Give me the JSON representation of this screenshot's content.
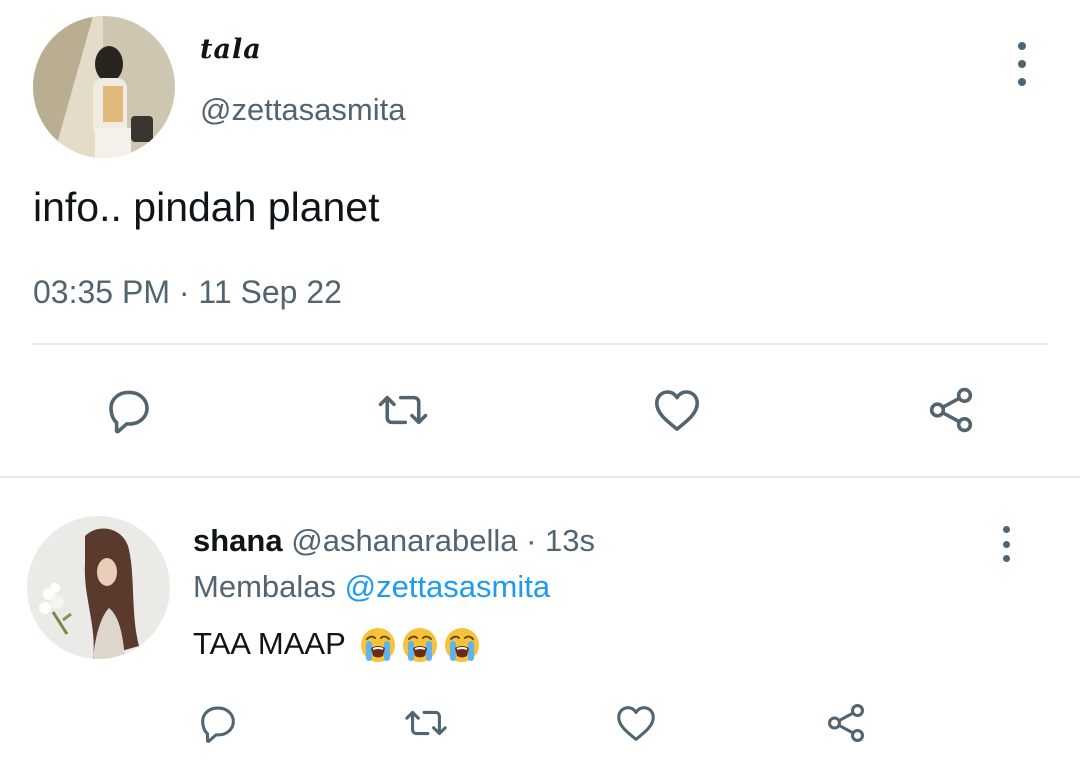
{
  "main_tweet": {
    "display_name": "tala",
    "handle": "@zettasasmita",
    "text": "info.. pindah planet",
    "timestamp": "03:35 PM · 11 Sep 22",
    "avatar_icon": "user-photo-avatar",
    "actions": [
      "reply-icon",
      "retweet-icon",
      "like-icon",
      "share-icon"
    ]
  },
  "reply": {
    "display_name": "shana",
    "handle": "@ashanarabella",
    "separator": "·",
    "time": "13s",
    "replying_label": "Membalas",
    "replying_to": "@zettasasmita",
    "text": "TAA MAAP",
    "emoji": [
      "loudly-crying-face",
      "loudly-crying-face",
      "loudly-crying-face"
    ],
    "avatar_icon": "user-photo-avatar",
    "actions": [
      "reply-icon",
      "retweet-icon",
      "like-icon",
      "share-icon"
    ]
  },
  "colors": {
    "text_primary": "#0f1419",
    "text_secondary": "#536471",
    "link": "#1d9bf0",
    "icon": "#536471",
    "divider": "#e6e9ec"
  }
}
